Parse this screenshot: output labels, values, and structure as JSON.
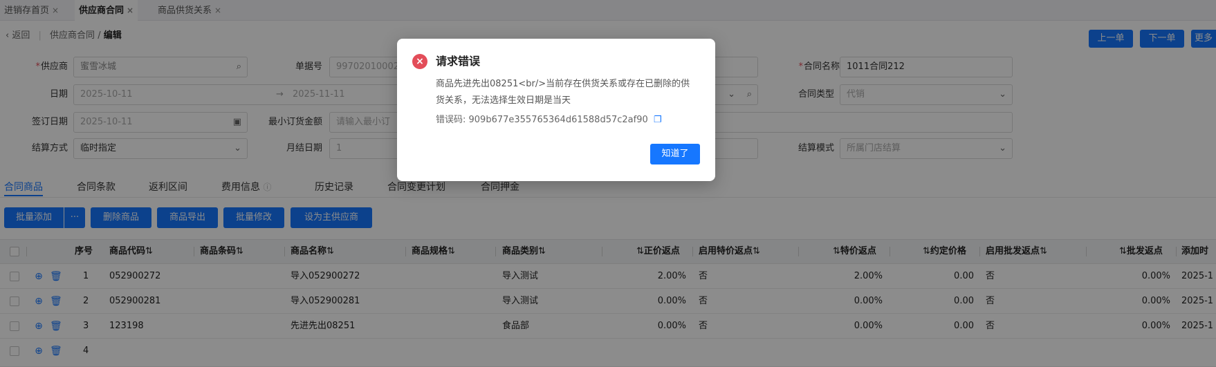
{
  "tabs": [
    {
      "label": "进销存首页",
      "close": "×"
    },
    {
      "label": "供应商合同",
      "close": "×"
    },
    {
      "label": "商品供货关系",
      "close": "×"
    }
  ],
  "breadcrumb": {
    "back": "返回",
    "parent": "供应商合同",
    "slash": "/",
    "current": "编辑"
  },
  "nav_buttons": {
    "prev": "上一单",
    "next": "下一单",
    "more": "更多"
  },
  "form": {
    "supplier": {
      "label": "供应商",
      "value": "蜜雪冰城"
    },
    "doc_no": {
      "label": "单据号",
      "value": "99702010002"
    },
    "contract_name": {
      "label": "合同名称",
      "value": "1011合同212"
    },
    "date": {
      "label": "日期",
      "start": "2025-10-11",
      "arrow": "→",
      "end": "2025-11-11"
    },
    "contract_type": {
      "label": "合同类型",
      "value": "代销"
    },
    "sign_date": {
      "label": "签订日期",
      "value": "2025-10-11"
    },
    "min_order": {
      "label": "最小订货金额",
      "placeholder": "请输入最小订"
    },
    "settle_method": {
      "label": "结算方式",
      "value": "临时指定"
    },
    "month_settle": {
      "label": "月结日期",
      "value": "1"
    },
    "settle_mode": {
      "label": "结算模式",
      "value": "所属门店结算"
    }
  },
  "content_tabs": [
    "合同商品",
    "合同条款",
    "返利区间",
    "费用信息",
    "历史记录",
    "合同变更计划",
    "合同押金"
  ],
  "toolbar": {
    "batch_add": "批量添加",
    "more": "···",
    "delete": "删除商品",
    "export": "商品导出",
    "batch_edit": "批量修改",
    "set_main": "设为主供应商"
  },
  "table": {
    "headers": {
      "seq": "序号",
      "code": "商品代码",
      "barcode": "商品条码",
      "name": "商品名称",
      "spec": "商品规格",
      "category": "商品类别",
      "normal_rebate": "正价返点",
      "enable_special": "启用特价返点",
      "special_rebate": "特价返点",
      "agreed_price": "约定价格",
      "enable_wholesale": "启用批发返点",
      "wholesale_rebate": "批发返点",
      "added": "添加时"
    },
    "rows": [
      {
        "seq": "1",
        "code": "052900272",
        "name": "导入052900272",
        "category": "导入测试",
        "normal_rebate": "2.00%",
        "enable_special": "否",
        "special_rebate": "2.00%",
        "agreed_price": "0.00",
        "enable_wholesale": "否",
        "wholesale_rebate": "0.00%",
        "added": "2025-1"
      },
      {
        "seq": "2",
        "code": "052900281",
        "name": "导入052900281",
        "category": "导入测试",
        "normal_rebate": "0.00%",
        "enable_special": "否",
        "special_rebate": "0.00%",
        "agreed_price": "0.00",
        "enable_wholesale": "否",
        "wholesale_rebate": "0.00%",
        "added": "2025-1"
      },
      {
        "seq": "3",
        "code": "123198",
        "name": "先进先出08251",
        "category": "食品部",
        "normal_rebate": "0.00%",
        "enable_special": "否",
        "special_rebate": "0.00%",
        "agreed_price": "0.00",
        "enable_wholesale": "否",
        "wholesale_rebate": "0.00%",
        "added": "2025-1"
      },
      {
        "seq": "4"
      }
    ]
  },
  "modal": {
    "title": "请求错误",
    "message": "商品先进先出08251<br/>当前存在供货关系或存在已删除的供货关系，无法选择生效日期是当天",
    "error_code_label": "错误码: ",
    "error_code": "909b677e355765364d61588d57c2af90",
    "ok": "知道了"
  },
  "colors": {
    "primary": "#1677ff",
    "error": "#e34d59"
  },
  "icons": {
    "search": "search-icon",
    "chevron": "chevron-down-icon",
    "calendar": "calendar-icon",
    "add": "plus-circle-icon",
    "delete": "trash-icon",
    "copy": "copy-icon",
    "error": "error-circle-icon",
    "help": "help-circle-icon"
  }
}
